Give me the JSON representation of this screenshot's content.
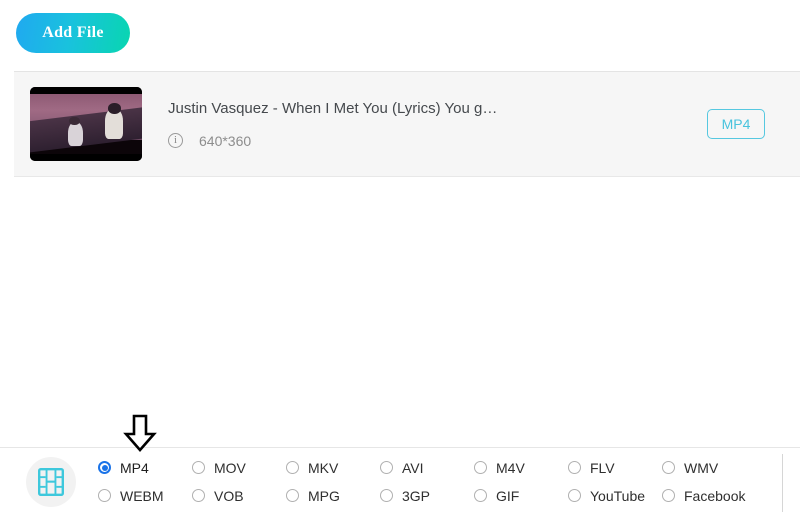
{
  "toolbar": {
    "add_file_label": "Add File"
  },
  "file_list": {
    "items": [
      {
        "title": "Justin Vasquez - When I Met You (Lyrics) You g…",
        "resolution": "640*360",
        "output_format": "MP4",
        "info_glyph": "i",
        "thumbnail_name": "video-thumbnail"
      }
    ]
  },
  "format_bar": {
    "media_icon": "film-strip-icon",
    "selected_format": "MP4",
    "options": [
      {
        "label": "MP4",
        "selected": true
      },
      {
        "label": "MOV",
        "selected": false
      },
      {
        "label": "MKV",
        "selected": false
      },
      {
        "label": "AVI",
        "selected": false
      },
      {
        "label": "M4V",
        "selected": false
      },
      {
        "label": "FLV",
        "selected": false
      },
      {
        "label": "WMV",
        "selected": false
      },
      {
        "label": "WEBM",
        "selected": false
      },
      {
        "label": "VOB",
        "selected": false
      },
      {
        "label": "MPG",
        "selected": false
      },
      {
        "label": "3GP",
        "selected": false
      },
      {
        "label": "GIF",
        "selected": false
      },
      {
        "label": "YouTube",
        "selected": false
      },
      {
        "label": "Facebook",
        "selected": false
      }
    ]
  },
  "annotation": {
    "arrow_name": "down-arrow-pointer",
    "points_at": "MP4"
  },
  "colors": {
    "accent_cyan": "#49c3dd",
    "radio_blue": "#1a73e8",
    "button_gradient_start": "#20a9f0",
    "button_gradient_end": "#08d6b0",
    "row_background": "#f6f6f6"
  }
}
